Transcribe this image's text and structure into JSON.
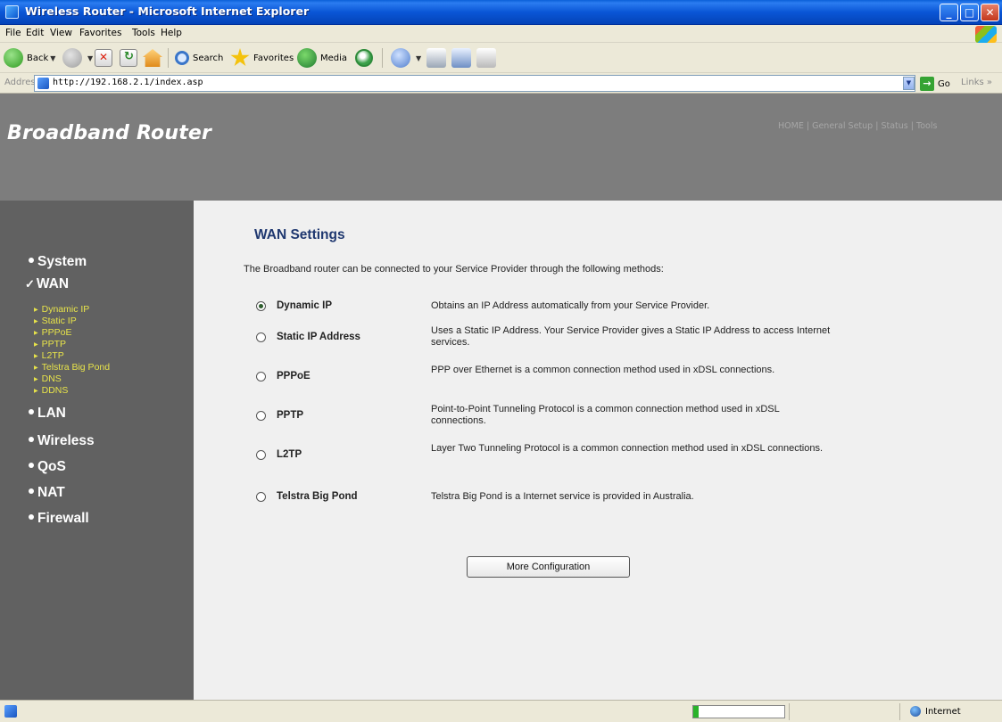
{
  "window": {
    "title": "Wireless Router - Microsoft Internet Explorer",
    "min": "_",
    "max": "□",
    "close": "✕"
  },
  "menu": [
    "File",
    "Edit",
    "View",
    "Favorites",
    "Tools",
    "Help"
  ],
  "toolbar": {
    "back": "Back",
    "search": "Search",
    "favorites": "Favorites",
    "media": "Media"
  },
  "address": {
    "label": "Address",
    "url": "http://192.168.2.1/index.asp",
    "go": "Go",
    "links": "Links »"
  },
  "router": {
    "brand": "Broadband Router",
    "topnav": [
      "HOME",
      "General Setup",
      "Status",
      "Tools"
    ],
    "sidebar": {
      "system": "System",
      "wan": "WAN",
      "wan_sub": [
        "Dynamic IP",
        "Static IP",
        "PPPoE",
        "PPTP",
        "L2TP",
        "Telstra Big Pond",
        "DNS",
        "DDNS"
      ],
      "lan": "LAN",
      "wireless": "Wireless",
      "qos": "QoS",
      "nat": "NAT",
      "firewall": "Firewall"
    },
    "content": {
      "title": "WAN Settings",
      "intro": "The Broadband router can be connected to your Service Provider through the following methods:",
      "options": [
        {
          "label": "Dynamic IP",
          "desc": "Obtains an IP Address automatically from your Service Provider.",
          "selected": true
        },
        {
          "label": "Static IP Address",
          "desc": "Uses a Static IP Address. Your Service Provider gives a Static IP Address to access Internet services.",
          "selected": false
        },
        {
          "label": "PPPoE",
          "desc": "PPP over Ethernet is a common connection method used in xDSL connections.",
          "selected": false
        },
        {
          "label": "PPTP",
          "desc": "Point-to-Point Tunneling Protocol is a common connection method used in xDSL connections.",
          "selected": false
        },
        {
          "label": "L2TP",
          "desc": "Layer Two Tunneling Protocol is a common connection method used in xDSL connections.",
          "selected": false
        },
        {
          "label": "Telstra Big Pond",
          "desc": "Telstra Big Pond is a Internet service is provided in Australia.",
          "selected": false
        }
      ],
      "more_button": "More Configuration"
    }
  },
  "status": {
    "zone": "Internet",
    "progress_fraction": 0.06
  }
}
